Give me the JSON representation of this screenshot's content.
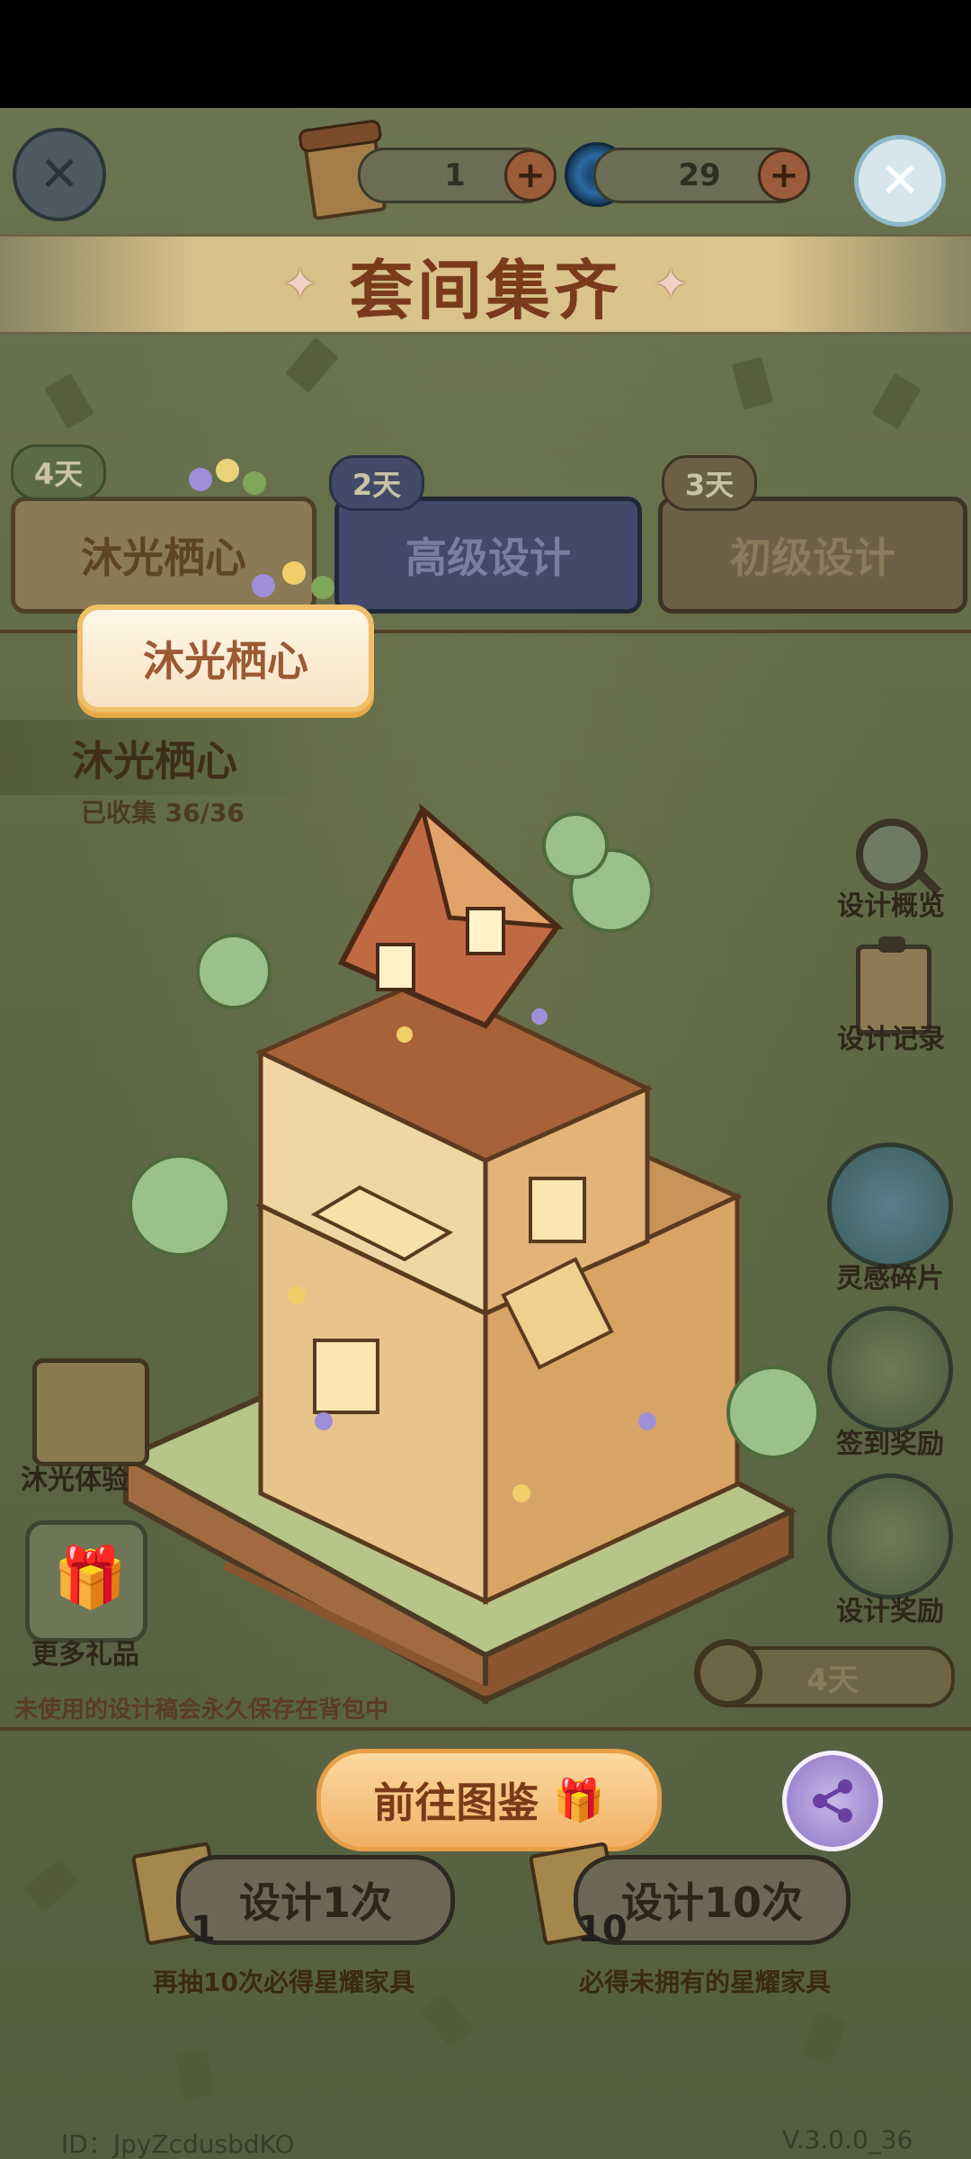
{
  "currencies": [
    {
      "icon": "design-ticket-icon",
      "value": "1"
    },
    {
      "icon": "spiral-gem-icon",
      "value": "29"
    }
  ],
  "banner": {
    "title": "套间集齐"
  },
  "tabs": [
    {
      "days": "4天",
      "label": "沐光栖心"
    },
    {
      "days": "2天",
      "label": "高级设计"
    },
    {
      "days": "3天",
      "label": "初级设计"
    }
  ],
  "selected_set": {
    "tag": "沐光栖心",
    "name": "沐光栖心",
    "collected": "已收集 36/36"
  },
  "right_side": [
    {
      "label": "设计概览",
      "icon": "magnifier-icon"
    },
    {
      "label": "设计记录",
      "icon": "clipboard-icon"
    },
    {
      "label": "灵感碎片",
      "icon": "map-fragment-icon"
    },
    {
      "label": "签到奖励",
      "icon": "calendar-icon"
    },
    {
      "label": "设计奖励",
      "icon": "reward-icon"
    }
  ],
  "left_side": [
    {
      "label": "沐光体验",
      "icon": "chest-icon"
    },
    {
      "label": "更多礼品",
      "icon": "gift-icon"
    }
  ],
  "note": "未使用的设计稿会永久保存在背包中",
  "timer": "4天",
  "goto_button": "前往图鉴",
  "draw_buttons": [
    {
      "label": "设计1次",
      "count": "1",
      "note": "再抽10次必得星耀家具"
    },
    {
      "label": "设计10次",
      "count": "10",
      "note": "必得未拥有的星耀家具"
    }
  ],
  "footer": {
    "id": "ID：JpyZcdusbdKO",
    "version": "V.3.0.0_36"
  }
}
